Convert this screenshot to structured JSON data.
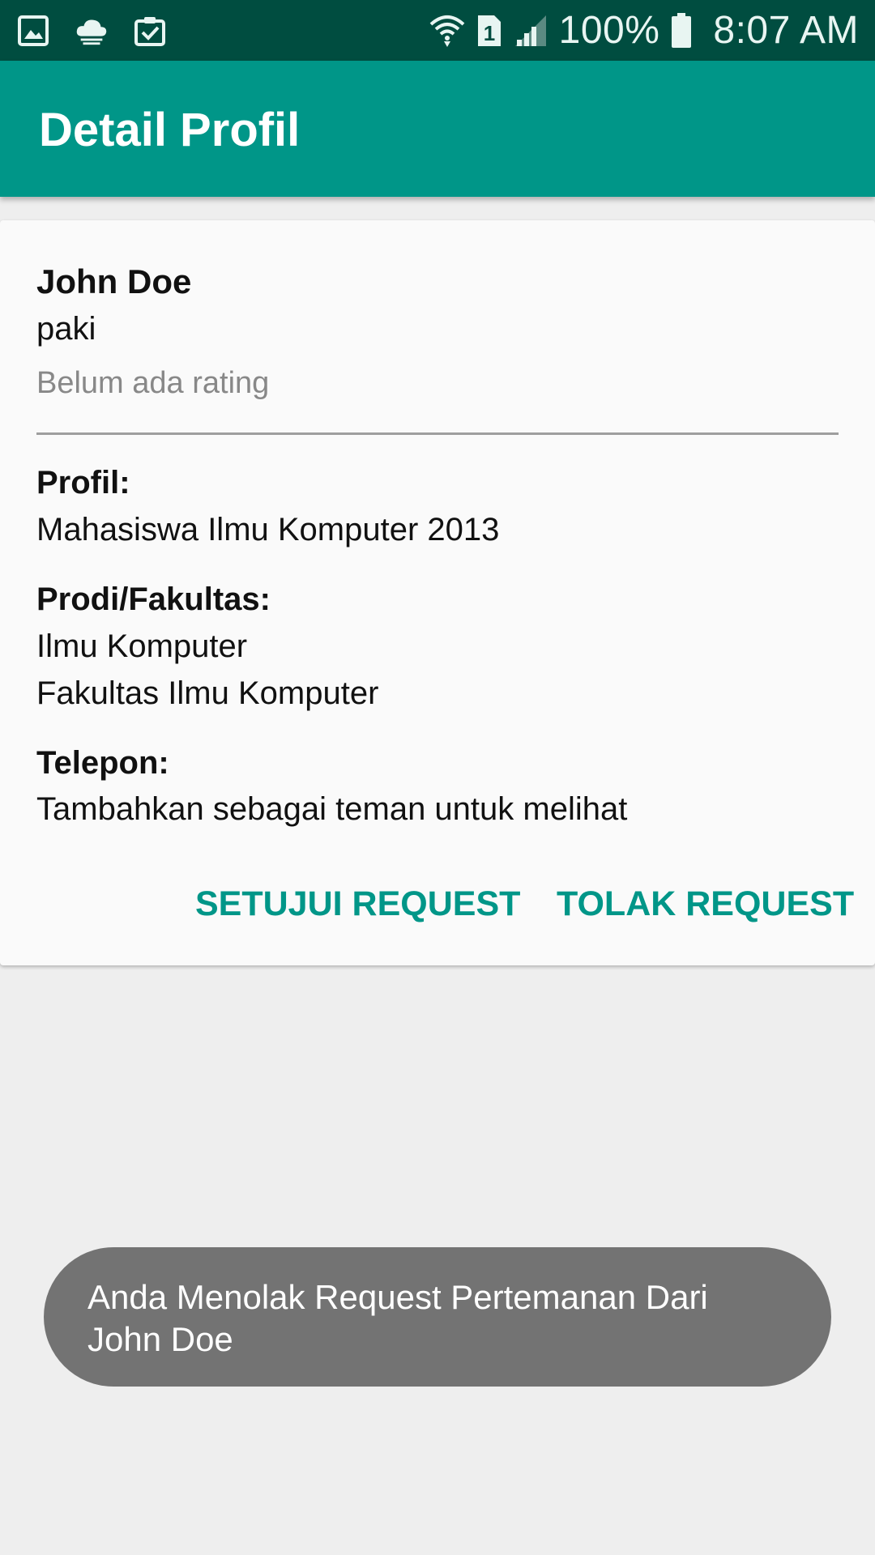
{
  "status_bar": {
    "icons_left": [
      "gallery-icon",
      "cloud-icon",
      "clipboard-check-icon"
    ],
    "icons_right": [
      "wifi-icon",
      "sim-icon",
      "signal-icon"
    ],
    "battery": "100%",
    "time": "8:07 AM",
    "background": "#004d40"
  },
  "app_bar": {
    "title": "Detail Profil",
    "color": "#009688"
  },
  "profile": {
    "name": "John Doe",
    "username": "paki",
    "rating": "Belum ada rating",
    "profil_label": "Profil:",
    "profil_value": "Mahasiswa Ilmu Komputer 2013",
    "prodi_label": "Prodi/Fakultas:",
    "prodi_line1": "Ilmu Komputer",
    "prodi_line2": "Fakultas Ilmu Komputer",
    "telepon_label": "Telepon:",
    "telepon_value": "Tambahkan sebagai teman untuk melihat"
  },
  "actions": {
    "approve": "SETUJUI REQUEST",
    "reject": "TOLAK REQUEST",
    "accent": "#009688"
  },
  "toast": {
    "message": "Anda Menolak Request Pertemanan Dari John Doe"
  }
}
